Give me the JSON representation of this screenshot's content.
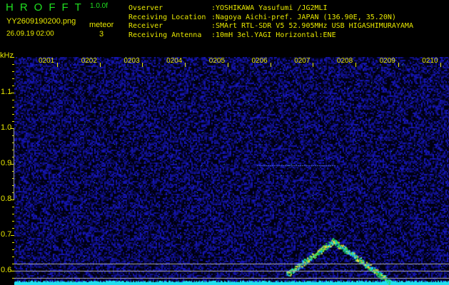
{
  "header": {
    "app_title": "HROFFT",
    "version": "1.0.0f",
    "filename": "YY2609190200.png",
    "meteor_label": "meteor",
    "datetime": "26.09.19 02:00",
    "meteor_count": "3"
  },
  "info": [
    {
      "label": "Ovserver",
      "value": ":YOSHIKAWA Yasufumi /JG2MLI"
    },
    {
      "label": "Receiving Location",
      "value": ":Nagoya Aichi-pref. JAPAN (136.90E, 35.20N)"
    },
    {
      "label": "Receiver",
      "value": ":SMArt RTL-SDR V5 52.905MHz USB HIGASHIMURAYAMA"
    },
    {
      "label": "Receiving Antenna",
      "value": ":10mH 3el.YAGI Horizontal:ENE"
    }
  ],
  "axis": {
    "y_unit": "kHz",
    "y_labels": [
      "1.1",
      "1.0",
      "0.9",
      "0.8",
      "0.7",
      "0.6"
    ],
    "time_labels": [
      "0201",
      "0202",
      "0203",
      "0204",
      "0205",
      "0206",
      "0207",
      "0208",
      "0209",
      "0210"
    ]
  },
  "colors": {
    "text": "#e8e800",
    "title": "#20e020",
    "noise": "#1010a0",
    "trace": "#00e0ff"
  }
}
